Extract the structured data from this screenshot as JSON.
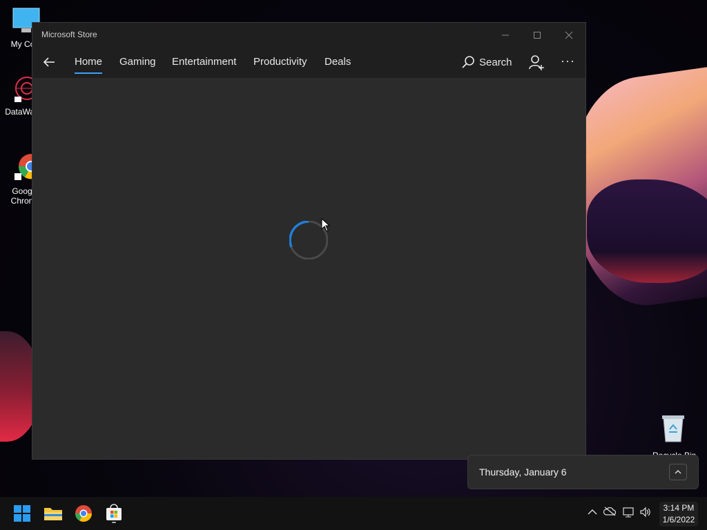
{
  "desktop": {
    "icons": [
      {
        "label": "My Com"
      },
      {
        "label": "DataWag"
      },
      {
        "label": "Goog\nChron"
      }
    ],
    "recycle_bin_label": "Recycle Bin"
  },
  "window": {
    "title": "Microsoft Store",
    "tabs": [
      {
        "label": "Home",
        "active": true
      },
      {
        "label": "Gaming"
      },
      {
        "label": "Entertainment"
      },
      {
        "label": "Productivity"
      },
      {
        "label": "Deals"
      }
    ],
    "search_label": "Search",
    "more_label": "···"
  },
  "flyout": {
    "date": "Thursday, January 6"
  },
  "taskbar": {
    "time": "3:14 PM",
    "date": "1/6/2022",
    "accent": "#3aa0ff"
  }
}
